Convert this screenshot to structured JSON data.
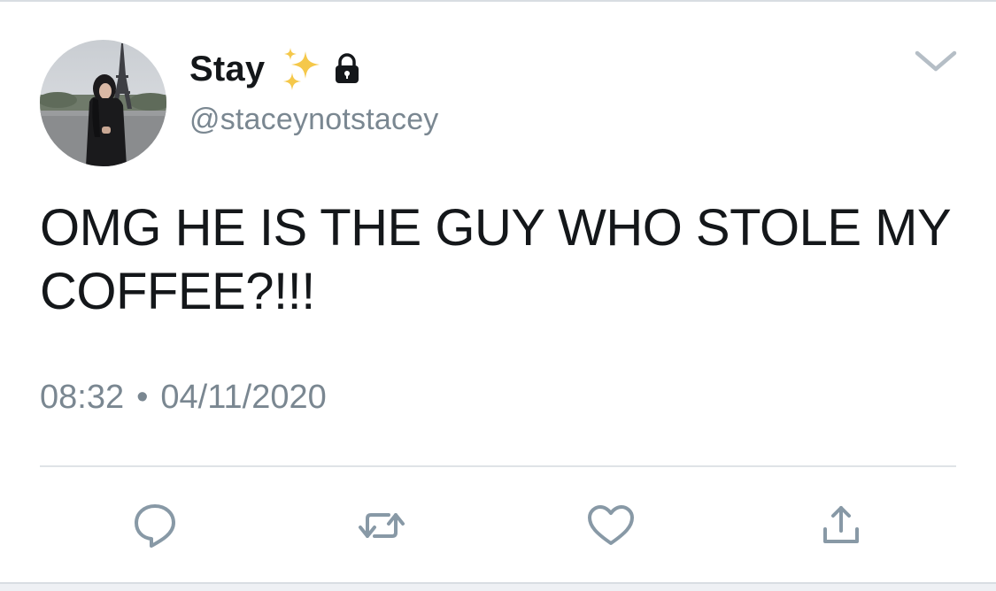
{
  "tweet": {
    "display_name": "Stay",
    "name_emoji": "sparkles-icon",
    "protected_icon": "lock-icon",
    "username": "@staceynotstacey",
    "text": "OMG HE IS THE GUY WHO STOLE MY COFFEE?!!!",
    "time": "08:32",
    "separator": "•",
    "date": "04/11/2020"
  },
  "actions": {
    "reply_icon": "reply-icon",
    "retweet_icon": "retweet-icon",
    "like_icon": "heart-icon",
    "share_icon": "share-icon"
  },
  "colors": {
    "text_primary": "#14171a",
    "text_secondary": "#7a8791",
    "icon_gray": "#8899a6",
    "divider": "#dfe3e7"
  }
}
